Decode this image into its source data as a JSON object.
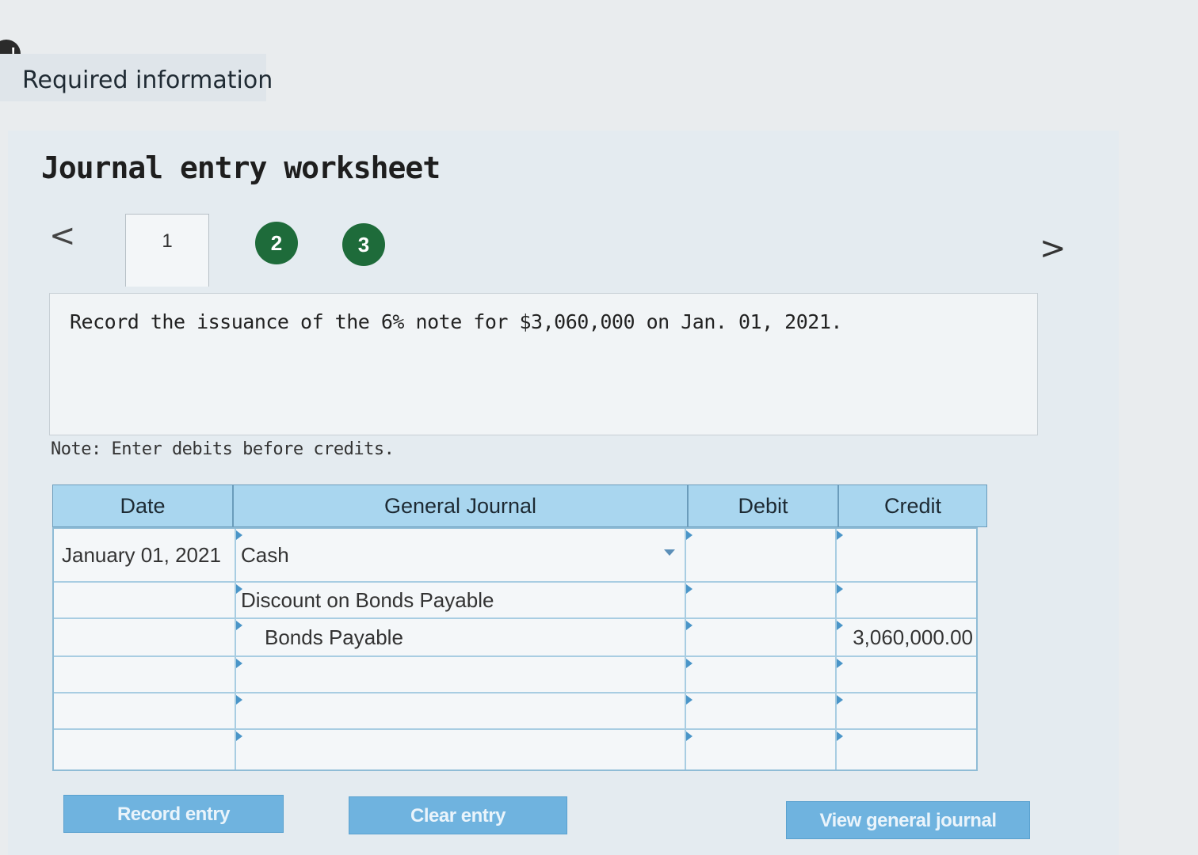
{
  "header": {
    "alert_symbol": "!",
    "required_information": "Required information"
  },
  "worksheet": {
    "title": "Journal entry worksheet",
    "nav_prev": "<",
    "nav_next": ">",
    "tabs": [
      {
        "label": "1",
        "active": true
      },
      {
        "label": "2",
        "completed": true
      },
      {
        "label": "3",
        "completed": true
      }
    ],
    "instruction": "Record the issuance of the 6% note for $3,060,000 on Jan. 01, 2021.",
    "note": "Note: Enter debits before credits."
  },
  "table": {
    "headers": {
      "date": "Date",
      "general_journal": "General Journal",
      "debit": "Debit",
      "credit": "Credit"
    },
    "rows": [
      {
        "date": "January 01, 2021",
        "account": "Cash",
        "debit": "",
        "credit": ""
      },
      {
        "date": "",
        "account": "Discount on Bonds Payable",
        "debit": "",
        "credit": ""
      },
      {
        "date": "",
        "account": "Bonds Payable",
        "debit": "",
        "credit": "3,060,000.00"
      },
      {
        "date": "",
        "account": "",
        "debit": "",
        "credit": ""
      },
      {
        "date": "",
        "account": "",
        "debit": "",
        "credit": ""
      },
      {
        "date": "",
        "account": "",
        "debit": "",
        "credit": ""
      }
    ]
  },
  "buttons": {
    "record_entry": "Record entry",
    "clear_entry": "Clear entry",
    "view_general_journal": "View general journal"
  },
  "colors": {
    "header_blue": "#a9d6ef",
    "button_blue": "#6fb3df",
    "tab_green": "#1e6b3a"
  }
}
